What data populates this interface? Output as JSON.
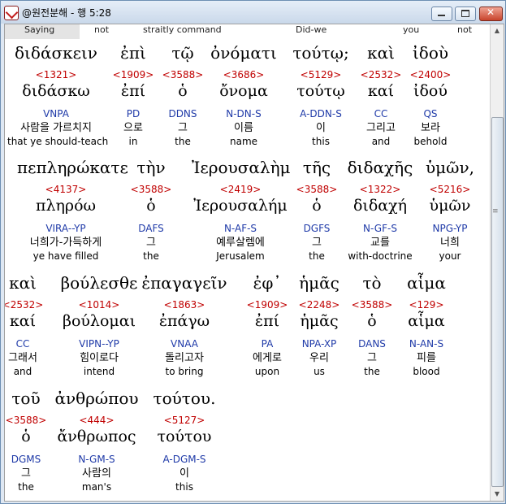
{
  "window": {
    "title": "@원전분해 - 행 5:28"
  },
  "topline": [
    "Saying",
    "not",
    "straitly command",
    "Did-we",
    "you",
    "not"
  ],
  "lines": [
    {
      "words": [
        {
          "greek": "διδάσκειν",
          "strong": "<1321>",
          "lemma": "διδάσκω",
          "parse": "VNPA",
          "korean": "사람을 가르치지",
          "english": "that ye should-teach"
        },
        {
          "greek": "ἐπὶ",
          "strong": "<1909>",
          "lemma": "ἐπί",
          "parse": "PD",
          "korean": "으로",
          "english": "in"
        },
        {
          "greek": "τῷ",
          "strong": "<3588>",
          "lemma": "ὁ",
          "parse": "DDNS",
          "korean": "그",
          "english": "the"
        },
        {
          "greek": "ὀνόματι",
          "strong": "<3686>",
          "lemma": "ὄνομα",
          "parse": "N-DN-S",
          "korean": "이름",
          "english": "name"
        },
        {
          "greek": "τούτῳ;",
          "strong": "<5129>",
          "lemma": "τούτῳ",
          "parse": "A-DDN-S",
          "korean": "이",
          "english": "this"
        },
        {
          "greek": "καὶ",
          "strong": "<2532>",
          "lemma": "καί",
          "parse": "CC",
          "korean": "그리고",
          "english": "and"
        },
        {
          "greek": "ἰδοὺ",
          "strong": "<2400>",
          "lemma": "ἰδού",
          "parse": "QS",
          "korean": "보라",
          "english": "behold"
        }
      ]
    },
    {
      "words": [
        {
          "greek": "πεπληρώκατε",
          "strong": "<4137>",
          "lemma": "πληρόω",
          "parse": "VIRA--YP",
          "korean": "너희가-가득하게",
          "english": "ye have filled"
        },
        {
          "greek": "τὴν",
          "strong": "<3588>",
          "lemma": "ὁ",
          "parse": "DAFS",
          "korean": "그",
          "english": "the"
        },
        {
          "greek": "Ἰερουσαλὴμ",
          "strong": "<2419>",
          "lemma": "Ἰερουσαλήμ",
          "parse": "N-AF-S",
          "korean": "예루살렘에",
          "english": "Jerusalem"
        },
        {
          "greek": "τῆς",
          "strong": "<3588>",
          "lemma": "ὁ",
          "parse": "DGFS",
          "korean": "그",
          "english": "the"
        },
        {
          "greek": "διδαχῆς",
          "strong": "<1322>",
          "lemma": "διδαχή",
          "parse": "N-GF-S",
          "korean": "교를",
          "english": "with-doctrine"
        },
        {
          "greek": "ὑμῶν,",
          "strong": "<5216>",
          "lemma": "ὑμῶν",
          "parse": "NPG-YP",
          "korean": "너희",
          "english": "your"
        }
      ]
    },
    {
      "words": [
        {
          "greek": "καὶ",
          "strong": "<2532>",
          "lemma": "καί",
          "parse": "CC",
          "korean": "그래서",
          "english": "and"
        },
        {
          "greek": "βούλεσθε",
          "strong": "<1014>",
          "lemma": "βούλομαι",
          "parse": "VIPN--YP",
          "korean": "힘이로다",
          "english": "intend"
        },
        {
          "greek": "ἐπαγαγεῖν",
          "strong": "<1863>",
          "lemma": "ἐπάγω",
          "parse": "VNAA",
          "korean": "돌리고자",
          "english": "to bring"
        },
        {
          "greek": "ἐφ᾽",
          "strong": "<1909>",
          "lemma": "ἐπί",
          "parse": "PA",
          "korean": "에게로",
          "english": "upon"
        },
        {
          "greek": "ἡμᾶς",
          "strong": "<2248>",
          "lemma": "ἡμᾶς",
          "parse": "NPA-XP",
          "korean": "우리",
          "english": "us"
        },
        {
          "greek": "τὸ",
          "strong": "<3588>",
          "lemma": "ὁ",
          "parse": "DANS",
          "korean": "그",
          "english": "the"
        },
        {
          "greek": "αἷμα",
          "strong": "<129>",
          "lemma": "αἷμα",
          "parse": "N-AN-S",
          "korean": "피를",
          "english": "blood"
        }
      ]
    },
    {
      "words": [
        {
          "greek": "τοῦ",
          "strong": "<3588>",
          "lemma": "ὁ",
          "parse": "DGMS",
          "korean": "그",
          "english": "the"
        },
        {
          "greek": "ἀνθρώπου",
          "strong": "<444>",
          "lemma": "ἄνθρωπος",
          "parse": "N-GM-S",
          "korean": "사람의",
          "english": "man's"
        },
        {
          "greek": "τούτου.",
          "strong": "<5127>",
          "lemma": "τούτου",
          "parse": "A-DGM-S",
          "korean": "이",
          "english": "this"
        }
      ]
    }
  ]
}
